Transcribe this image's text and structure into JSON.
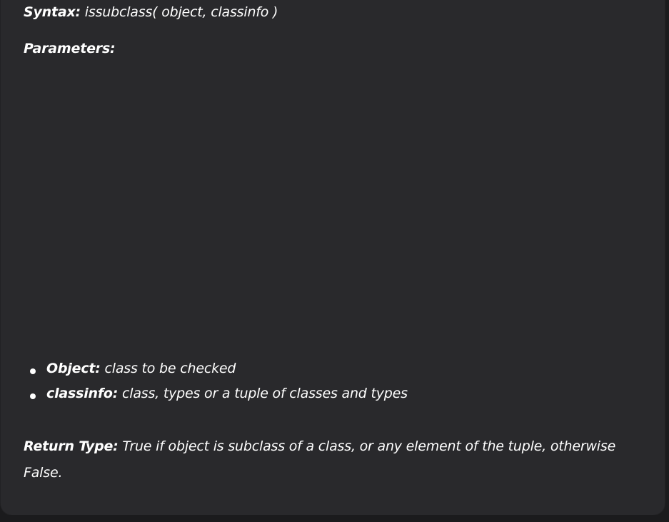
{
  "syntax": {
    "label": "Syntax:",
    "value": " issubclass( object, classinfo )"
  },
  "parameters": {
    "label": "Parameters:"
  },
  "bullets": [
    {
      "term": "Object:",
      "description": " class to be checked"
    },
    {
      "term": "classinfo:",
      "description": " class, types or a tuple of classes and types"
    }
  ],
  "return_type": {
    "label": "Return Type:",
    "description": " True if object is subclass of a class, or any element of the tuple, otherwise False."
  },
  "colors": {
    "background": "#1b1b1d",
    "card": "#29292c",
    "text": "#ffffff",
    "accent": "#2f8d46"
  }
}
